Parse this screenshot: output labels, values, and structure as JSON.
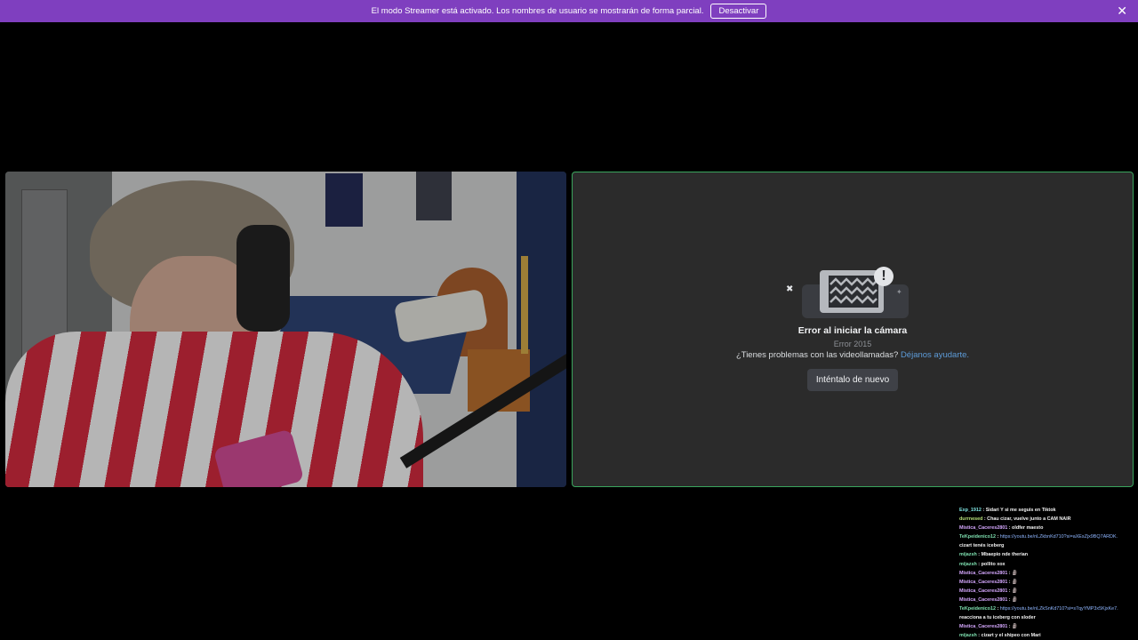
{
  "banner": {
    "message": "El modo Streamer está activado. Los nombres de usuario se mostrarán de forma parcial.",
    "button_label": "Desactivar",
    "close_glyph": "✕"
  },
  "error_panel": {
    "title": "Error al iniciar la cámara",
    "code": "Error 2015",
    "help_text": "¿Tienes problemas con las videollamadas?",
    "help_link": "Déjanos ayudarte.",
    "retry_label": "Inténtalo de nuevo",
    "alert_glyph": "!",
    "x_glyph": "✖"
  },
  "chat": {
    "messages": [
      {
        "user": "Exp_1912",
        "user_color": "#7ee2e0",
        "text": "Sidari Y si me seguis en Tiktok"
      },
      {
        "user": "durrnesed",
        "user_color": "#b7e07a",
        "text": "Chau cizar, vuelve junto a CAM NAIR"
      },
      {
        "user": "Mistica_Caceres2801",
        "user_color": "#d6a8ff",
        "text": "oldfer maesto"
      },
      {
        "user": "TeKpeidenico12",
        "user_color": "#7ee0b0",
        "text": "",
        "link": "https://youtu.be/nLZkbnKd710?si=aXEsZjx9BQ7ARDK."
      },
      {
        "user": "",
        "user_color": "#f2f2f2",
        "text": "cizart tenés iceberg"
      },
      {
        "user": "mijazsh",
        "user_color": "#7ee0b0",
        "text": "Mbaepio nde therian"
      },
      {
        "user": "mijazsh",
        "user_color": "#7ee0b0",
        "text": "pollito xox"
      },
      {
        "user": "Mistica_Caceres2801",
        "user_color": "#d6a8ff",
        "text": "🗿"
      },
      {
        "user": "Mistica_Caceres2801",
        "user_color": "#d6a8ff",
        "text": "🗿"
      },
      {
        "user": "Mistica_Caceres2801",
        "user_color": "#d6a8ff",
        "text": "🗿"
      },
      {
        "user": "Mistica_Caceres2801",
        "user_color": "#d6a8ff",
        "text": "🗿"
      },
      {
        "user": "TeKpeidenico12",
        "user_color": "#7ee0b0",
        "text": "",
        "link": "https://youtu.be/nLZkSnKd710?si=s7qyYMP3x5KjxKe7."
      },
      {
        "user": "",
        "user_color": "#f2f2f2",
        "text": "reacciona a tu iceberg con sloder"
      },
      {
        "user": "Mistica_Caceres2801",
        "user_color": "#d6a8ff",
        "text": "🗿"
      },
      {
        "user": "mijazsh",
        "user_color": "#7ee0b0",
        "text": "cizart y el shipeo con Mari"
      }
    ]
  },
  "colors": {
    "banner_bg": "#7f3fbf",
    "speaking_border": "#3aa55d",
    "link": "#5d9bd8"
  }
}
